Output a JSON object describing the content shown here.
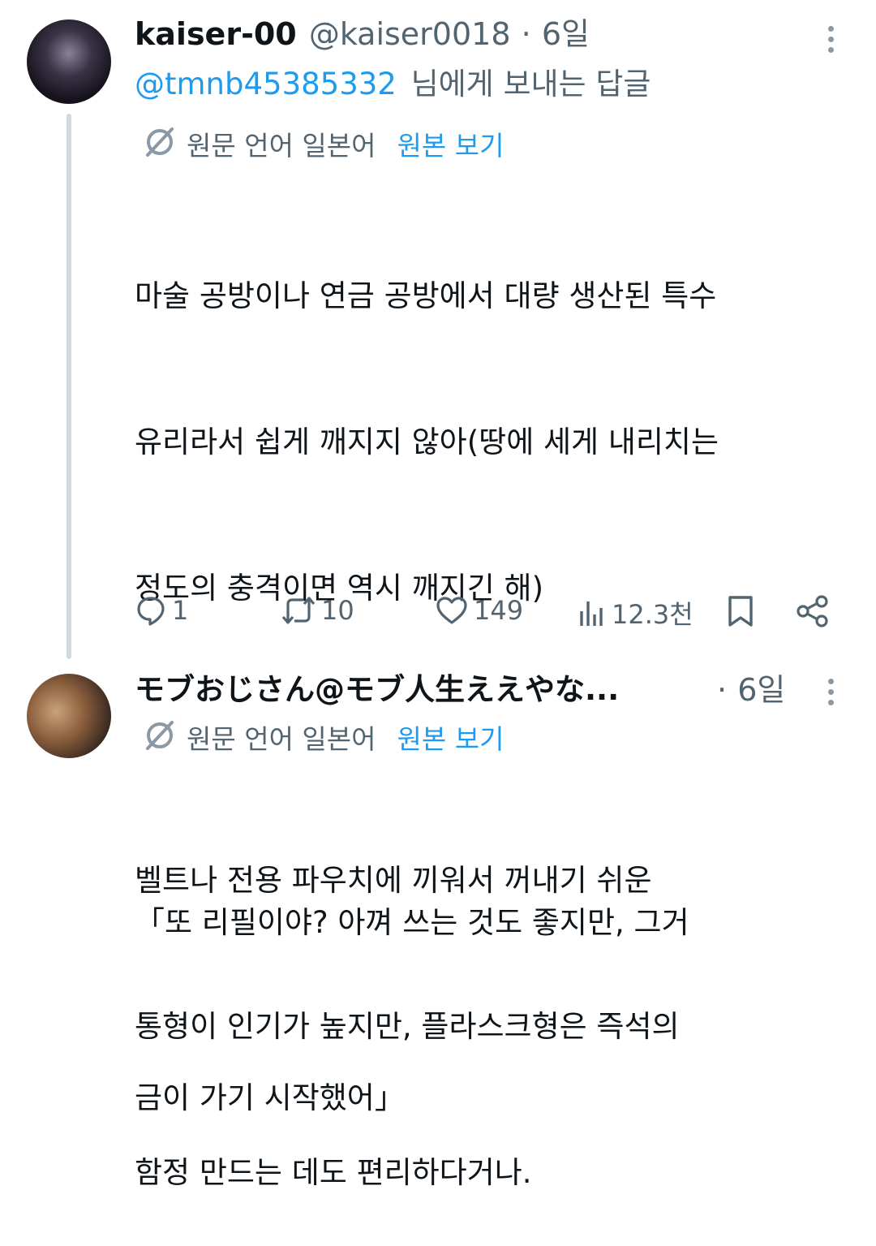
{
  "tweet1": {
    "display_name": "kaiser-00",
    "handle": "@kaiser0018",
    "separator": "·",
    "time": "6일",
    "reply_to_handle": "@tmnb45385332",
    "reply_to_suffix": "님에게 보내는 답글",
    "translation_label": "원문 언어 일본어",
    "show_original": "원본 보기",
    "body_lines": [
      "마술 공방이나 연금 공방에서 대량 생산된 특수",
      "유리라서 쉽게 깨지지 않아(땅에 세게 내리치는",
      "정도의 충격이면 역시 깨지긴 해)",
      "",
      "벨트나 전용 파우치에 끼워서 꺼내기 쉬운",
      "통형이 인기가 높지만, 플라스크형은 즉석의",
      "함정 만드는 데도 편리하다거나."
    ],
    "actions": {
      "replies": "1",
      "retweets": "10",
      "likes": "149",
      "views": "12.3천"
    }
  },
  "tweet2": {
    "display_name": "モブおじさん@モブ人生ええやな...",
    "separator": "·",
    "time": "6일",
    "translation_label": "원문 언어 일본어",
    "show_original": "원본 보기",
    "body_lines": [
      "「또 리필이야? 아껴 쓰는 것도 좋지만, 그거",
      "금이 가기 시작했어」"
    ]
  },
  "colors": {
    "link": "#1d9bf0",
    "secondary": "#536471",
    "text": "#0f1419",
    "thread_line": "#cfd9de"
  },
  "icons": [
    "more-icon",
    "translate-icon",
    "reply-icon",
    "retweet-icon",
    "like-icon",
    "views-icon",
    "bookmark-icon",
    "share-icon"
  ]
}
